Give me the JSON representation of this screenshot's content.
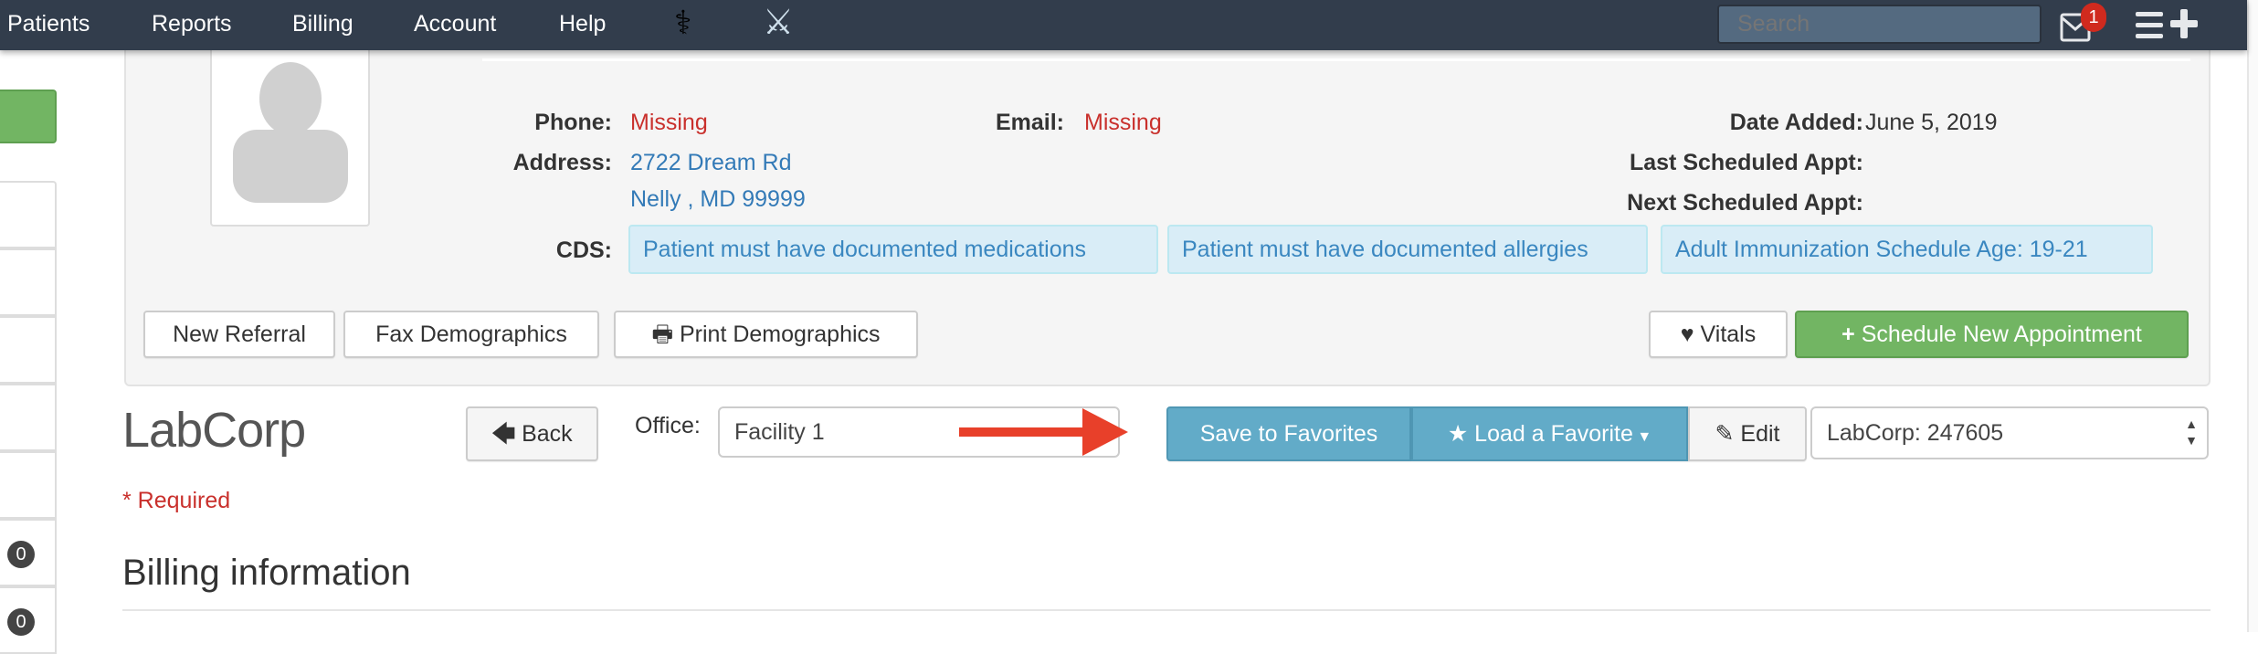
{
  "nav": {
    "items": [
      "Patients",
      "Reports",
      "Billing",
      "Account",
      "Help"
    ],
    "search_placeholder": "Search",
    "mail_badge": "1",
    "icons": [
      "caduceus-icon",
      "crossed-swords-icon",
      "mail-icon",
      "menu-icon",
      "plus-icon"
    ]
  },
  "sidebar": {
    "badges": [
      "0",
      "0"
    ],
    "accent": "#72b563"
  },
  "patient": {
    "phone_label": "Phone:",
    "phone": "Missing",
    "email_label": "Email:",
    "email": "Missing",
    "address_label": "Address:",
    "address1": "2722 Dream Rd",
    "address2": "Nelly , MD 99999",
    "date_added_label": "Date Added:",
    "date_added": "June 5, 2019",
    "last_appt_label": "Last Scheduled Appt:",
    "next_appt_label": "Next Scheduled Appt:",
    "cds_label": "CDS:",
    "cds": [
      "Patient must have documented medications",
      "Patient must have documented allergies",
      "Adult Immunization Schedule Age: 19-21"
    ],
    "buttons": {
      "new_referral": "New Referral",
      "fax": "Fax Demographics",
      "print": "Print Demographics",
      "vitals": "Vitals",
      "schedule": "Schedule New Appointment"
    }
  },
  "lab": {
    "title": "LabCorp",
    "back": "Back",
    "office_label": "Office:",
    "office_value": "Facility 1",
    "save_fav": "Save to Favorites",
    "load_fav": "Load a Favorite",
    "edit": "Edit",
    "lab_select": "LabCorp: 247605",
    "required": "* Required",
    "billing_heading": "Billing information"
  },
  "colors": {
    "nav": "#323d4c",
    "info": "#62abc8",
    "success": "#72b563",
    "danger": "#c9302c",
    "arrow": "#e8402a"
  }
}
